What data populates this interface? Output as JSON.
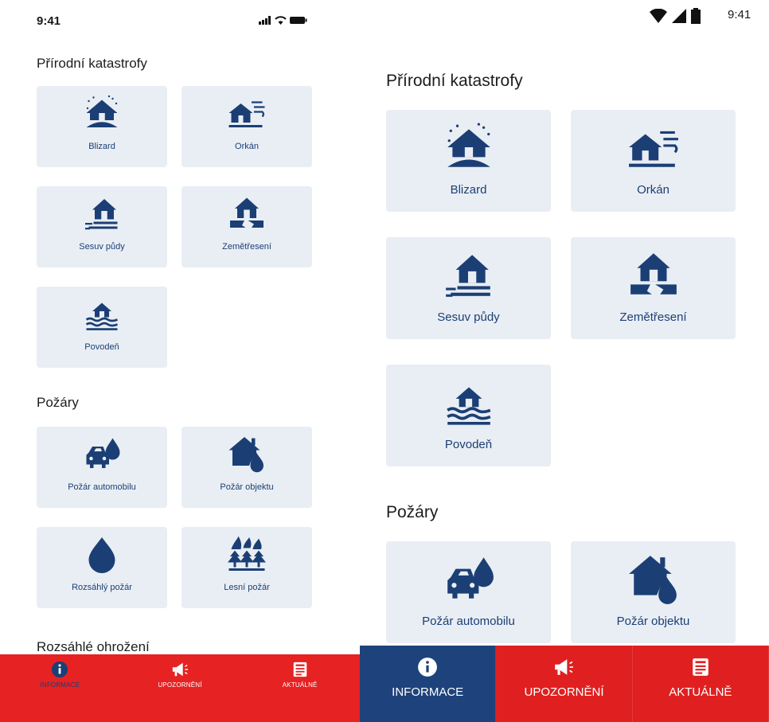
{
  "ios": {
    "status": {
      "time": "9:41"
    },
    "sections": [
      {
        "title": "Přírodní katastrofy"
      },
      {
        "title": "Požáry"
      },
      {
        "title": "Rozsáhlé ohrožení"
      }
    ],
    "tiles": [
      {
        "label": "Blizard",
        "icon": "blizzard-house-icon"
      },
      {
        "label": "Orkán",
        "icon": "hurricane-house-icon"
      },
      {
        "label": "Sesuv půdy",
        "icon": "landslide-house-icon"
      },
      {
        "label": "Zemětřesení",
        "icon": "earthquake-house-icon"
      },
      {
        "label": "Povodeň",
        "icon": "flood-house-icon"
      },
      {
        "label": "Požár automobilu",
        "icon": "car-fire-icon"
      },
      {
        "label": "Požár objektu",
        "icon": "building-fire-icon"
      },
      {
        "label": "Rozsáhlý požár",
        "icon": "flame-drop-icon"
      },
      {
        "label": "Lesní požár",
        "icon": "forest-fire-icon"
      }
    ],
    "nav": [
      {
        "label": "INFORMACE",
        "icon": "info-icon",
        "active": true
      },
      {
        "label": "UPOZORNĚNÍ",
        "icon": "megaphone-icon",
        "active": false
      },
      {
        "label": "AKTUÁLNĚ",
        "icon": "news-icon",
        "active": false
      }
    ]
  },
  "android": {
    "status": {
      "time": "9:41"
    },
    "sections": [
      {
        "title": "Přírodní katastrofy"
      },
      {
        "title": "Požáry"
      }
    ],
    "tiles": [
      {
        "label": "Blizard",
        "icon": "blizzard-house-icon"
      },
      {
        "label": "Orkán",
        "icon": "hurricane-house-icon"
      },
      {
        "label": "Sesuv půdy",
        "icon": "landslide-house-icon"
      },
      {
        "label": "Zemětřesení",
        "icon": "earthquake-house-icon"
      },
      {
        "label": "Povodeň",
        "icon": "flood-house-icon"
      },
      {
        "label": "Požár automobilu",
        "icon": "car-fire-icon"
      },
      {
        "label": "Požár objektu",
        "icon": "building-fire-icon"
      }
    ],
    "nav": [
      {
        "label": "INFORMACE",
        "icon": "info-icon",
        "active": true
      },
      {
        "label": "UPOZORNĚNÍ",
        "icon": "megaphone-icon",
        "active": false
      },
      {
        "label": "AKTUÁLNĚ",
        "icon": "news-icon",
        "active": false
      }
    ]
  },
  "colors": {
    "primary": "#1b3f75",
    "tile_bg": "#e9eef4",
    "nav_red": "#e62222",
    "nav_active": "#1e437c"
  }
}
